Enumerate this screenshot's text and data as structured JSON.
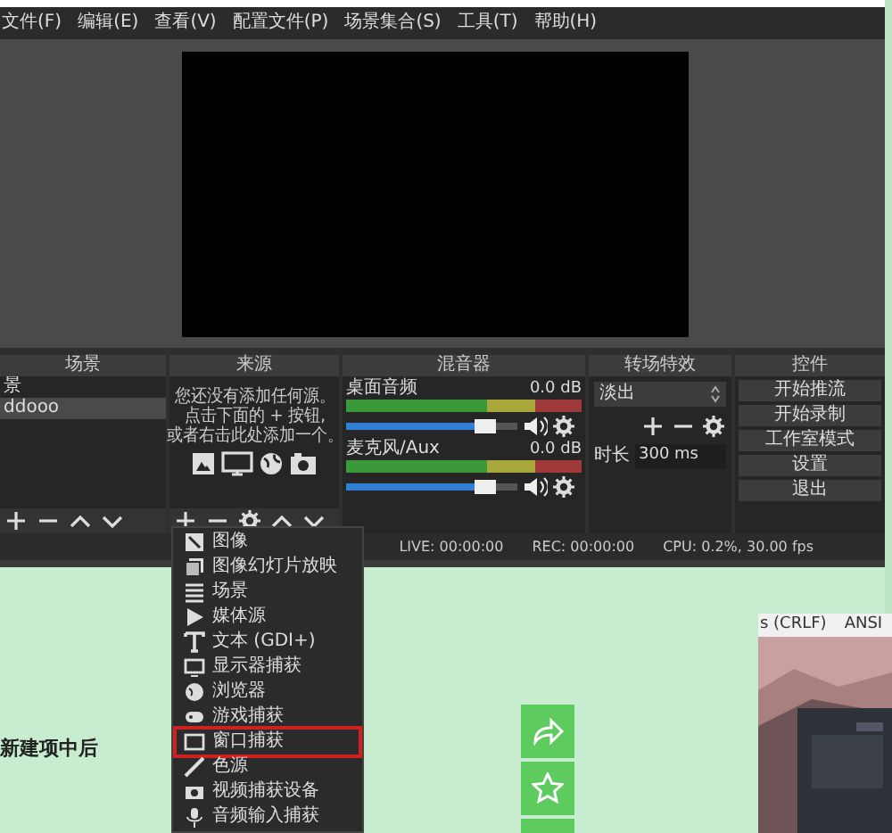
{
  "menu_bar": [
    "文件(F)",
    "编辑(E)",
    "查看(V)",
    "配置文件(P)",
    "场景集合(S)",
    "工具(T)",
    "帮助(H)"
  ],
  "scenes": {
    "title": "场景",
    "items": [
      {
        "label": "景",
        "selected": false
      },
      {
        "label": "ddooo",
        "selected": true
      }
    ]
  },
  "sources": {
    "title": "来源",
    "hint": [
      "您还没有添加任何源。",
      "点击下面的 + 按钮,",
      "或者右击此处添加一个。"
    ]
  },
  "mixer": {
    "title": "混音器",
    "channels": [
      {
        "name": "桌面音频",
        "reading": "0.0 dB",
        "level": 0.88
      },
      {
        "name": "麦克风/Aux",
        "reading": "0.0 dB",
        "level": 0.88
      }
    ]
  },
  "transitions": {
    "title": "转场特效",
    "transition": "淡出",
    "duration_label": "时长",
    "duration": "300 ms"
  },
  "controls": {
    "title": "控件",
    "buttons": [
      "开始推流",
      "开始录制",
      "工作室模式",
      "设置",
      "退出"
    ]
  },
  "status_bar": [
    "LIVE: 00:00:00",
    "REC: 00:00:00",
    "CPU: 0.2%, 30.00 fps"
  ],
  "add_source_menu": [
    {
      "label": "图像",
      "selected": false
    },
    {
      "label": "图像幻灯片放映",
      "selected": false
    },
    {
      "label": "场景",
      "selected": false
    },
    {
      "label": "媒体源",
      "selected": false
    },
    {
      "label": "文本 (GDI+)",
      "selected": false
    },
    {
      "label": "显示器捕获",
      "selected": false
    },
    {
      "label": "浏览器",
      "selected": false
    },
    {
      "label": "游戏捕获",
      "selected": false
    },
    {
      "label": "窗口捕获",
      "selected": true
    },
    {
      "label": "色源",
      "selected": false
    },
    {
      "label": "视频捕获设备",
      "selected": false
    },
    {
      "label": "音频输入捕获",
      "selected": false
    }
  ],
  "background_page": {
    "heading": "新建项中后",
    "editor_status": [
      "s (CRLF)",
      "ANSI"
    ]
  }
}
